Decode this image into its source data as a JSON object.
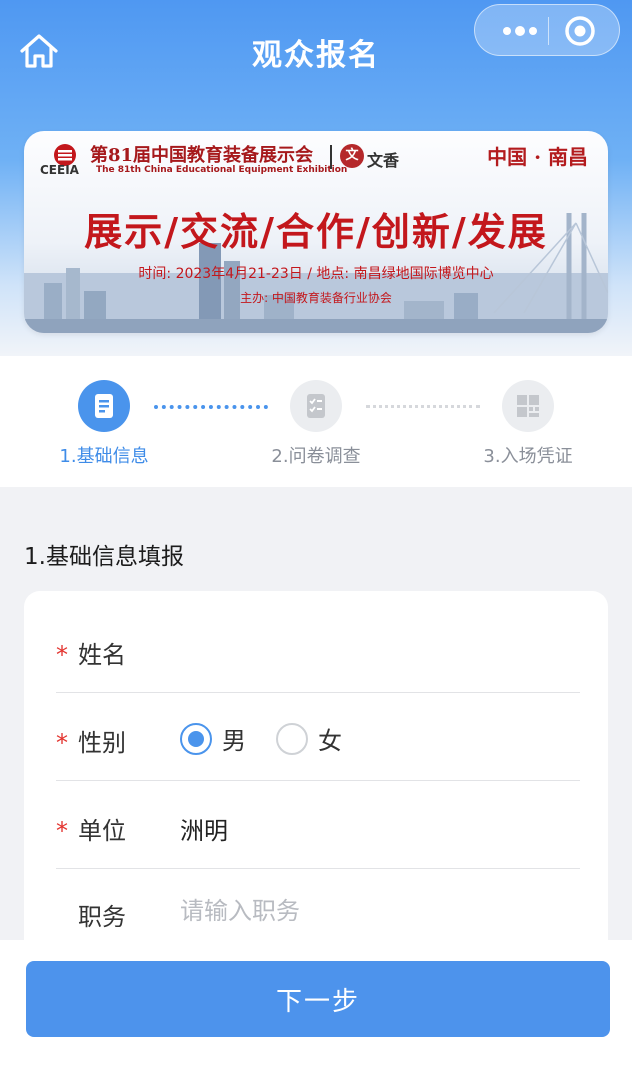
{
  "header": {
    "title": "观众报名"
  },
  "banner": {
    "logo_text": "CEEIA",
    "expo_name_cn": "第81届中国教育装备展示会",
    "expo_name_en": "The 81th China Educational Equipment Exhibition",
    "partner_logo_char": "文",
    "partner_text": "文香",
    "location": "中国 · 南昌",
    "slogan": "展示/交流/合作/创新/发展",
    "info_line1": "时间: 2023年4月21-23日 / 地点: 南昌绿地国际博览中心",
    "info_line2": "主办: 中国教育装备行业协会"
  },
  "steps": [
    {
      "label": "1.基础信息",
      "icon": "document-icon",
      "active": true
    },
    {
      "label": "2.问卷调查",
      "icon": "checklist-icon",
      "active": false
    },
    {
      "label": "3.入场凭证",
      "icon": "qr-code-icon",
      "active": false
    }
  ],
  "section": {
    "title": "1.基础信息填报"
  },
  "form": {
    "name": {
      "label": "姓名",
      "required": true,
      "value": ""
    },
    "gender": {
      "label": "性别",
      "required": true,
      "options": [
        "男",
        "女"
      ],
      "selected": "男"
    },
    "company": {
      "label": "单位",
      "required": true,
      "value": "洲明"
    },
    "position": {
      "label": "职务",
      "required": false,
      "placeholder": "请输入职务"
    },
    "required_mark": "*"
  },
  "footer": {
    "next_label": "下一步"
  },
  "colors": {
    "primary": "#4a94ec",
    "required": "#e3342f",
    "banner_red": "#c3171c"
  }
}
